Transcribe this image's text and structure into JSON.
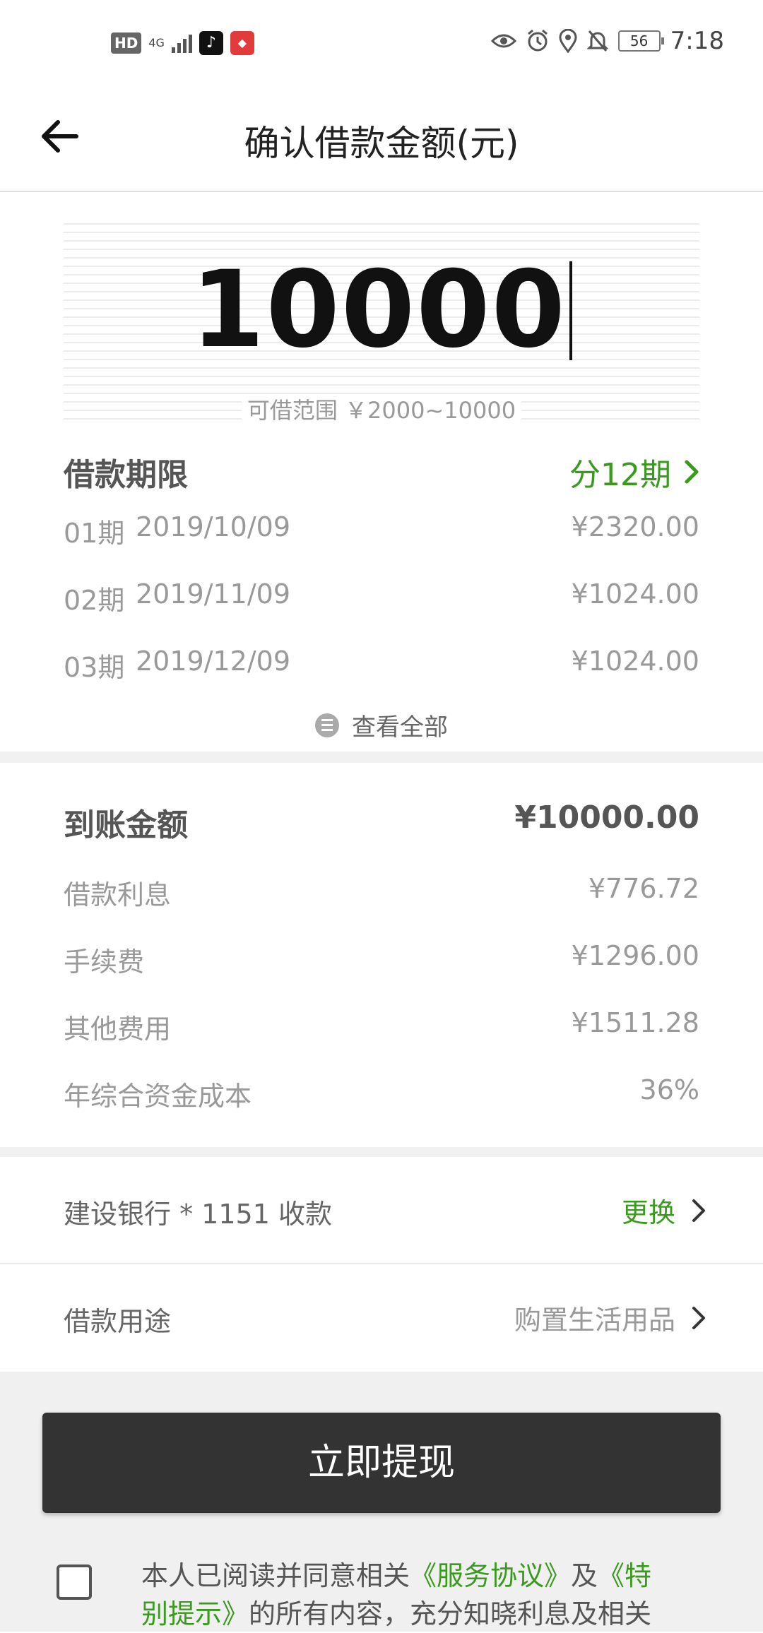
{
  "status_bar": {
    "hd": "HD",
    "network": "4G",
    "battery": "56",
    "time": "7:18"
  },
  "header": {
    "title": "确认借款金额(元)",
    "back_icon": "arrow-left-icon"
  },
  "amount": {
    "value": "10000",
    "range": "可借范围 ￥2000~10000"
  },
  "term": {
    "title": "借款期限",
    "value": "分12期",
    "schedule": [
      {
        "period": "01期",
        "date": "2019/10/09",
        "amount": "¥2320.00"
      },
      {
        "period": "02期",
        "date": "2019/11/09",
        "amount": "¥1024.00"
      },
      {
        "period": "03期",
        "date": "2019/12/09",
        "amount": "¥1024.00"
      }
    ],
    "view_all": "查看全部"
  },
  "details": {
    "received": {
      "label": "到账金额",
      "value": "¥10000.00"
    },
    "interest": {
      "label": "借款利息",
      "value": "¥776.72"
    },
    "fee": {
      "label": "手续费",
      "value": "¥1296.00"
    },
    "other": {
      "label": "其他费用",
      "value": "¥1511.28"
    },
    "annual_cost": {
      "label": "年综合资金成本",
      "value": "36%"
    }
  },
  "bank": {
    "label": "建设银行 * 1151 收款",
    "action": "更换"
  },
  "purpose": {
    "label": "借款用途",
    "value": "购置生活用品"
  },
  "submit": {
    "label": "立即提现"
  },
  "agreement": {
    "prefix": "本人已阅读并同意相关",
    "link1": "《服务协议》",
    "middle": "及",
    "link2": "《特别提示》",
    "suffix": "的所有内容，充分知晓利息及相关"
  },
  "colors": {
    "accent": "#3a9a1e",
    "button": "#333333"
  }
}
